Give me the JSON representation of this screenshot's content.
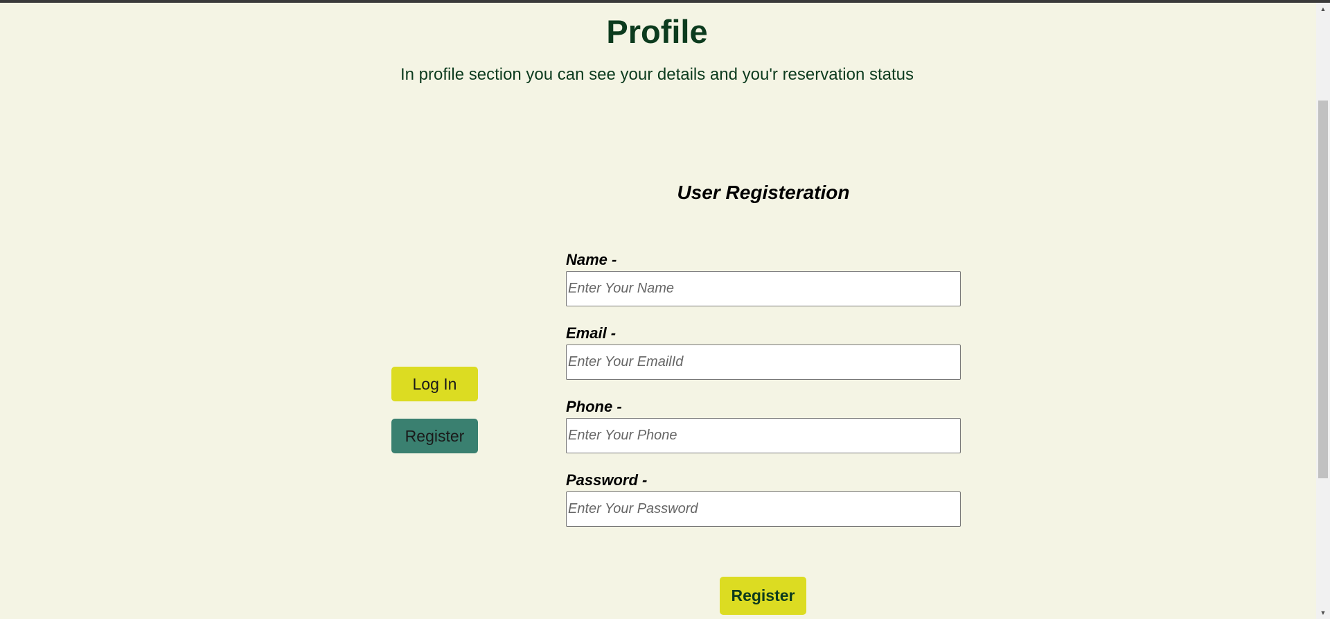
{
  "header": {
    "title": "Profile",
    "subtitle": "In profile section you can see your details and you'r reservation status"
  },
  "side_nav": {
    "login_label": "Log In",
    "register_label": "Register"
  },
  "form": {
    "title": "User Registeration",
    "fields": [
      {
        "label": "Name -",
        "placeholder": "Enter Your Name"
      },
      {
        "label": "Email -",
        "placeholder": "Enter Your EmailId"
      },
      {
        "label": "Phone -",
        "placeholder": "Enter Your Phone"
      },
      {
        "label": "Password -",
        "placeholder": "Enter Your Password"
      }
    ],
    "submit_label": "Register"
  },
  "scrollbar": {
    "up_icon": "triangle-up-icon",
    "down_icon": "triangle-down-icon"
  },
  "colors": {
    "background": "#f4f4e4",
    "heading": "#0c3b1e",
    "accent_yellow": "#dcdc22",
    "accent_green": "#3a8070"
  }
}
